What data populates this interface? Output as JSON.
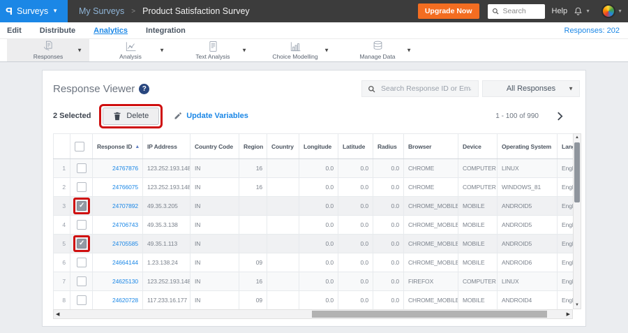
{
  "topbar": {
    "logo_letter": "P",
    "product_menu": "Surveys",
    "breadcrumb_parent": "My Surveys",
    "breadcrumb_separator": ">",
    "breadcrumb_current": "Product Satisfaction Survey",
    "upgrade_label": "Upgrade Now",
    "search_placeholder": "Search",
    "help_label": "Help"
  },
  "nav": {
    "items": [
      {
        "label": "Edit",
        "active": false
      },
      {
        "label": "Distribute",
        "active": false
      },
      {
        "label": "Analytics",
        "active": true
      },
      {
        "label": "Integration",
        "active": false
      }
    ],
    "responses_label": "Responses: 202"
  },
  "toolbar": {
    "items": [
      {
        "label": "Responses",
        "icon": "responses-icon",
        "active": true
      },
      {
        "label": "Analysis",
        "icon": "analysis-icon",
        "active": false
      },
      {
        "label": "Text Analysis",
        "icon": "text-analysis-icon",
        "active": false
      },
      {
        "label": "Choice Modelling",
        "icon": "choice-modelling-icon",
        "active": false
      },
      {
        "label": "Manage Data",
        "icon": "manage-data-icon",
        "active": false
      }
    ]
  },
  "viewer": {
    "title": "Response Viewer",
    "help_badge": "?",
    "search_placeholder": "Search Response ID or Email",
    "filter_value": "All Responses",
    "selected_label": "2 Selected",
    "delete_label": "Delete",
    "update_variables_label": "Update Variables",
    "pagination_label": "1 - 100 of 990"
  },
  "table": {
    "columns": [
      "Response ID",
      "IP Address",
      "Country Code",
      "Region",
      "Country",
      "Longitude",
      "Latitude",
      "Radius",
      "Browser",
      "Device",
      "Operating System",
      "Language"
    ],
    "sort_column": "Response ID",
    "sort_direction": "asc",
    "rows": [
      {
        "num": 1,
        "checked": false,
        "response_id": "24767876",
        "ip": "123.252.193.148",
        "country_code": "IN",
        "region": "16",
        "country": "",
        "longitude": "0.0",
        "latitude": "0.0",
        "radius": "0.0",
        "browser": "CHROME",
        "device": "COMPUTER",
        "os": "LINUX",
        "language": "English"
      },
      {
        "num": 2,
        "checked": false,
        "response_id": "24766075",
        "ip": "123.252.193.148",
        "country_code": "IN",
        "region": "16",
        "country": "",
        "longitude": "0.0",
        "latitude": "0.0",
        "radius": "0.0",
        "browser": "CHROME",
        "device": "COMPUTER",
        "os": "WINDOWS_81",
        "language": "English"
      },
      {
        "num": 3,
        "checked": true,
        "response_id": "24707892",
        "ip": "49.35.3.205",
        "country_code": "IN",
        "region": "",
        "country": "",
        "longitude": "0.0",
        "latitude": "0.0",
        "radius": "0.0",
        "browser": "CHROME_MOBILE",
        "device": "MOBILE",
        "os": "ANDROID5",
        "language": "English"
      },
      {
        "num": 4,
        "checked": false,
        "response_id": "24706743",
        "ip": "49.35.3.138",
        "country_code": "IN",
        "region": "",
        "country": "",
        "longitude": "0.0",
        "latitude": "0.0",
        "radius": "0.0",
        "browser": "CHROME_MOBILE",
        "device": "MOBILE",
        "os": "ANDROID5",
        "language": "English"
      },
      {
        "num": 5,
        "checked": true,
        "response_id": "24705585",
        "ip": "49.35.1.113",
        "country_code": "IN",
        "region": "",
        "country": "",
        "longitude": "0.0",
        "latitude": "0.0",
        "radius": "0.0",
        "browser": "CHROME_MOBILE",
        "device": "MOBILE",
        "os": "ANDROID5",
        "language": "English"
      },
      {
        "num": 6,
        "checked": false,
        "response_id": "24664144",
        "ip": "1.23.138.24",
        "country_code": "IN",
        "region": "09",
        "country": "",
        "longitude": "0.0",
        "latitude": "0.0",
        "radius": "0.0",
        "browser": "CHROME_MOBILE",
        "device": "MOBILE",
        "os": "ANDROID6",
        "language": "English"
      },
      {
        "num": 7,
        "checked": false,
        "response_id": "24625130",
        "ip": "123.252.193.148",
        "country_code": "IN",
        "region": "16",
        "country": "",
        "longitude": "0.0",
        "latitude": "0.0",
        "radius": "0.0",
        "browser": "FIREFOX",
        "device": "COMPUTER",
        "os": "LINUX",
        "language": "English"
      },
      {
        "num": 8,
        "checked": false,
        "response_id": "24620728",
        "ip": "117.233.16.177",
        "country_code": "IN",
        "region": "09",
        "country": "",
        "longitude": "0.0",
        "latitude": "0.0",
        "radius": "0.0",
        "browser": "CHROME_MOBILE",
        "device": "MOBILE",
        "os": "ANDROID4",
        "language": "English"
      }
    ]
  },
  "colors": {
    "accent_blue": "#1b87e6",
    "upgrade_orange": "#f36d21",
    "topbar_bg": "#3c3c3c",
    "highlight_red": "#cf0f0f",
    "page_bg": "#ebedf0"
  }
}
